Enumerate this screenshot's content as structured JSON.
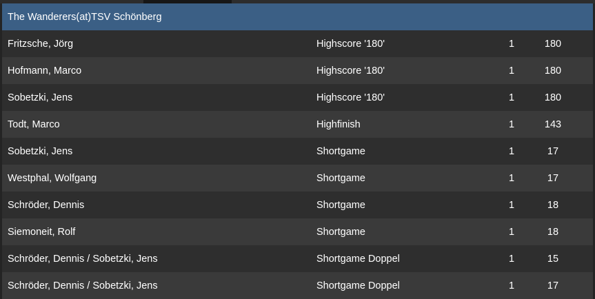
{
  "team": {
    "title": "The Wanderers(at)TSV Schönberg"
  },
  "rows": [
    {
      "name": "Fritzsche, Jörg",
      "category": "Highscore '180'",
      "count": "1",
      "score": "180"
    },
    {
      "name": "Hofmann, Marco",
      "category": "Highscore '180'",
      "count": "1",
      "score": "180"
    },
    {
      "name": "Sobetzki, Jens",
      "category": "Highscore '180'",
      "count": "1",
      "score": "180"
    },
    {
      "name": "Todt, Marco",
      "category": "Highfinish",
      "count": "1",
      "score": "143"
    },
    {
      "name": "Sobetzki, Jens",
      "category": "Shortgame",
      "count": "1",
      "score": "17"
    },
    {
      "name": "Westphal, Wolfgang",
      "category": "Shortgame",
      "count": "1",
      "score": "17"
    },
    {
      "name": "Schröder, Dennis",
      "category": "Shortgame",
      "count": "1",
      "score": "18"
    },
    {
      "name": "Siemoneit, Rolf",
      "category": "Shortgame",
      "count": "1",
      "score": "18"
    },
    {
      "name": "Schröder, Dennis / Sobetzki, Jens",
      "category": "Shortgame Doppel",
      "count": "1",
      "score": "15"
    },
    {
      "name": "Schröder, Dennis / Sobetzki, Jens",
      "category": "Shortgame Doppel",
      "count": "1",
      "score": "17"
    }
  ],
  "colors": {
    "header_bg": "#3b5f85",
    "row_odd": "#2e2e2e",
    "row_even": "#3a3a3a",
    "text": "#ffffff"
  }
}
